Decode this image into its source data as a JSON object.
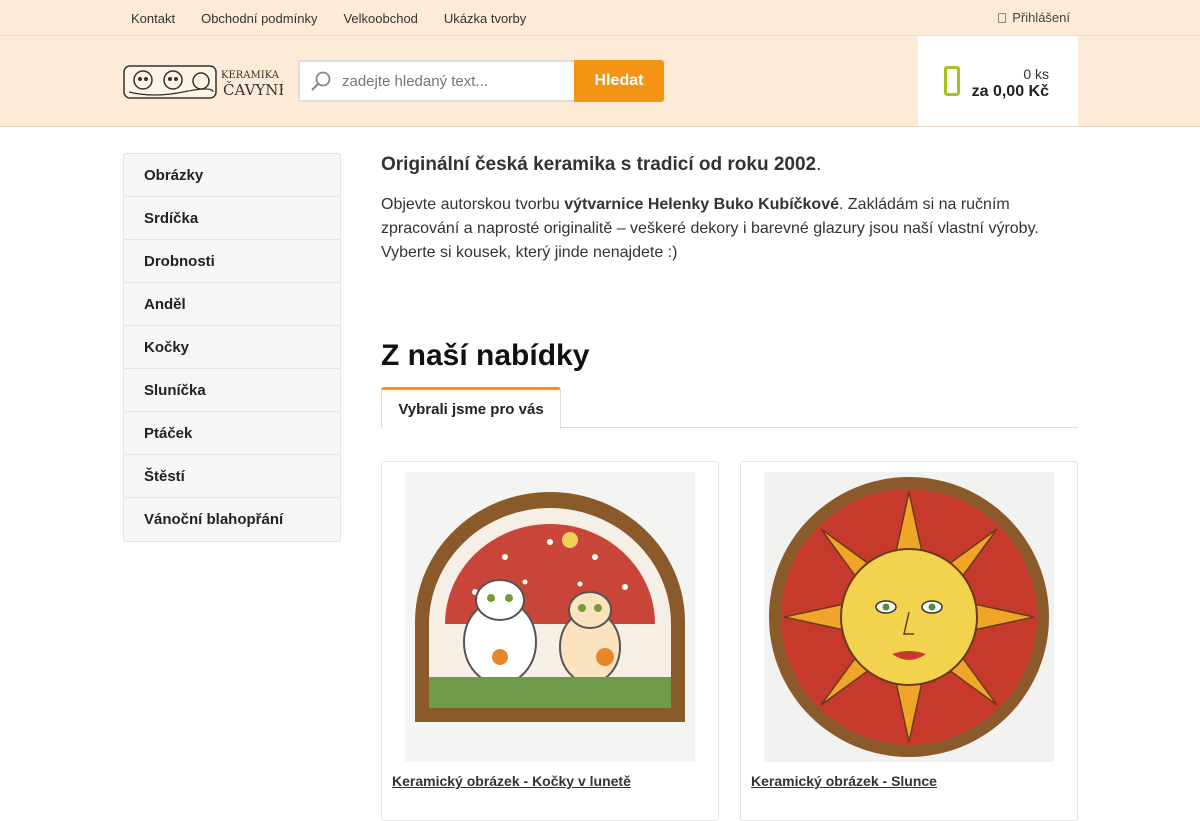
{
  "topnav": {
    "links": [
      "Kontakt",
      "Obchodní podmínky",
      "Velkoobchod",
      "Ukázka tvorby"
    ],
    "login": "Přihlášení"
  },
  "header": {
    "logo_text_line1": "KERAMIKA",
    "logo_text_line2": "ČAVYNĚ",
    "search_placeholder": "zadejte hledaný text...",
    "search_button": "Hledat",
    "cart_count": "0 ks",
    "cart_total": "za 0,00 Kč"
  },
  "sidebar": {
    "items": [
      "Obrázky",
      "Srdíčka",
      "Drobnosti",
      "Anděl",
      "Kočky",
      "Sluníčka",
      "Ptáček",
      "Štěstí",
      "Vánoční blahopřání"
    ]
  },
  "main": {
    "lead": "Originální česká keramika s tradicí od roku 2002",
    "lead_dot": ".",
    "intro_pre": "Objevte autorskou tvorbu ",
    "intro_bold": "výtvarnice Helenky Buko Kubíčkové",
    "intro_post": ". Zakládám si na ručním zpracování a naprosté originalitě – veškeré dekory i barevné glazury jsou naší vlastní výroby. Vyberte si kousek, který jinde nenajdete :)",
    "section_title": "Z naší nabídky",
    "tab_label": "Vybrali jsme pro vás",
    "products": [
      {
        "name": "Keramický obrázek - Kočky v lunetě"
      },
      {
        "name": "Keramický obrázek - Slunce"
      }
    ]
  },
  "colors": {
    "header_bg": "#fdebd7",
    "accent": "#f39415",
    "cart_icon": "#a8c020"
  }
}
